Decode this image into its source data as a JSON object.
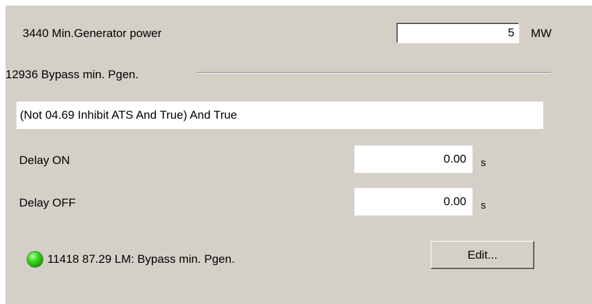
{
  "generator": {
    "label": "3440 Min.Generator power",
    "value": "5",
    "unit": "MW"
  },
  "bypass_group": {
    "title": "12936 Bypass min. Pgen."
  },
  "condition": {
    "expression": "(Not 04.69 Inhibit ATS And True) And True"
  },
  "delay_on": {
    "label": "Delay ON",
    "value": "0.00",
    "unit": "s"
  },
  "delay_off": {
    "label": "Delay OFF",
    "value": "0.00",
    "unit": "s"
  },
  "status": {
    "text": "11418 87.29 LM: Bypass min. Pgen.",
    "led_color": "#3fd81e",
    "icon": "status-led-icon"
  },
  "edit_button": {
    "label": "Edit..."
  }
}
